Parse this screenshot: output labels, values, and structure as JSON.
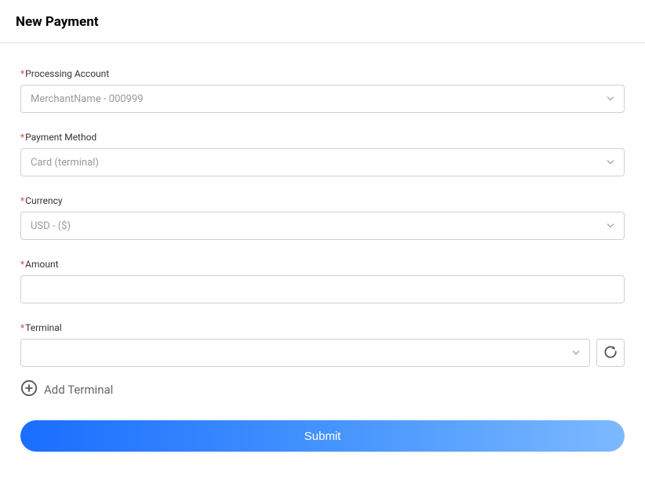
{
  "header": {
    "title": "New Payment"
  },
  "form": {
    "processing_account": {
      "label": "Processing Account",
      "value": "MerchantName - 000999"
    },
    "payment_method": {
      "label": "Payment Method",
      "value": "Card (terminal)"
    },
    "currency": {
      "label": "Currency",
      "value": "USD - ($)"
    },
    "amount": {
      "label": "Amount",
      "value": ""
    },
    "terminal": {
      "label": "Terminal",
      "value": ""
    },
    "add_terminal_label": "Add Terminal",
    "submit_label": "Submit",
    "required_mark": "*"
  }
}
